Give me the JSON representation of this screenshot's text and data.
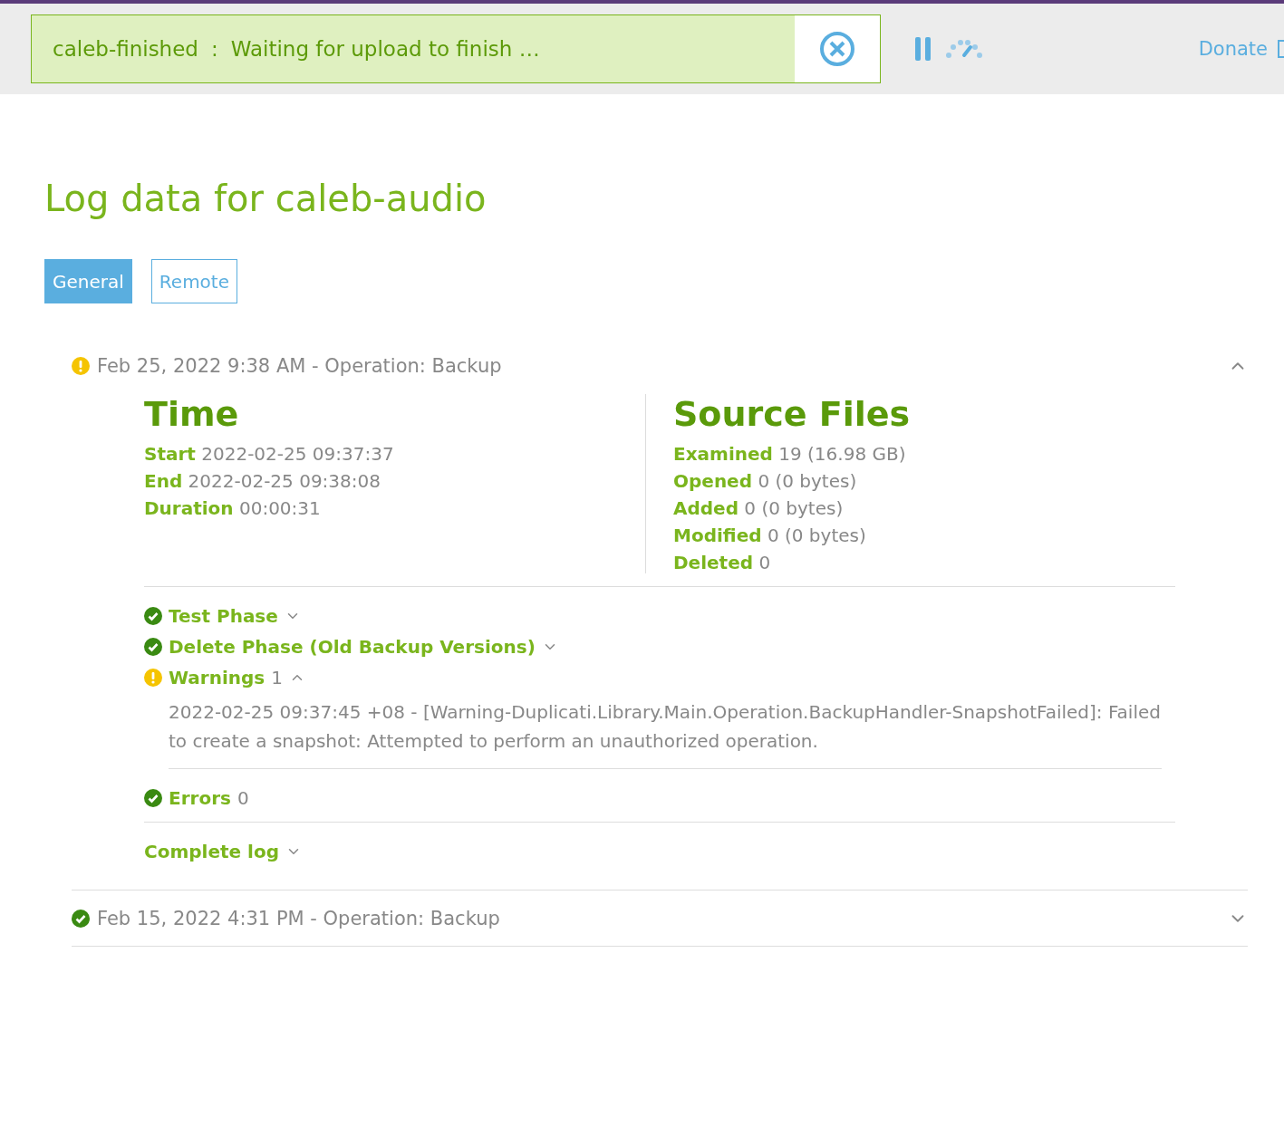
{
  "status_bar": {
    "backup_name": "caleb-finished",
    "separator": ":",
    "message": "Waiting for upload to finish …",
    "donate": "Donate"
  },
  "title": "Log data for caleb-audio",
  "tabs": [
    {
      "label": "General",
      "selected": true
    },
    {
      "label": "Remote",
      "selected": false
    }
  ],
  "entries": [
    {
      "kind": "warning",
      "heading": "Feb 25, 2022 9:38 AM - Operation: Backup",
      "expanded": true,
      "time": {
        "title": "Time",
        "rows": [
          {
            "label": "Start",
            "value": "2022-02-25 09:37:37"
          },
          {
            "label": "End",
            "value": "2022-02-25 09:38:08"
          },
          {
            "label": "Duration",
            "value": "00:00:31"
          }
        ]
      },
      "source": {
        "title": "Source Files",
        "rows": [
          {
            "label": "Examined",
            "value": "19 (16.98 GB)"
          },
          {
            "label": "Opened",
            "value": "0 (0 bytes)"
          },
          {
            "label": "Added",
            "value": "0 (0 bytes)"
          },
          {
            "label": "Modified",
            "value": "0 (0 bytes)"
          },
          {
            "label": "Deleted",
            "value": "0"
          }
        ]
      },
      "phases": [
        {
          "kind": "ok",
          "label": "Test Phase",
          "expanded": false
        },
        {
          "kind": "ok",
          "label": "Delete Phase (Old Backup Versions)",
          "expanded": false
        },
        {
          "kind": "warning",
          "label": "Warnings",
          "count": "1",
          "expanded": true,
          "messages": [
            "2022-02-25 09:37:45 +08 - [Warning-Duplicati.Library.Main.Operation.BackupHandler-SnapshotFailed]: Failed to create a snapshot: Attempted to perform an unauthorized operation."
          ]
        },
        {
          "kind": "ok",
          "label": "Errors",
          "count": "0"
        }
      ],
      "complete_log": {
        "label": "Complete log",
        "expanded": false
      }
    },
    {
      "kind": "ok",
      "heading": "Feb 15, 2022 4:31 PM - Operation: Backup",
      "expanded": false
    }
  ]
}
